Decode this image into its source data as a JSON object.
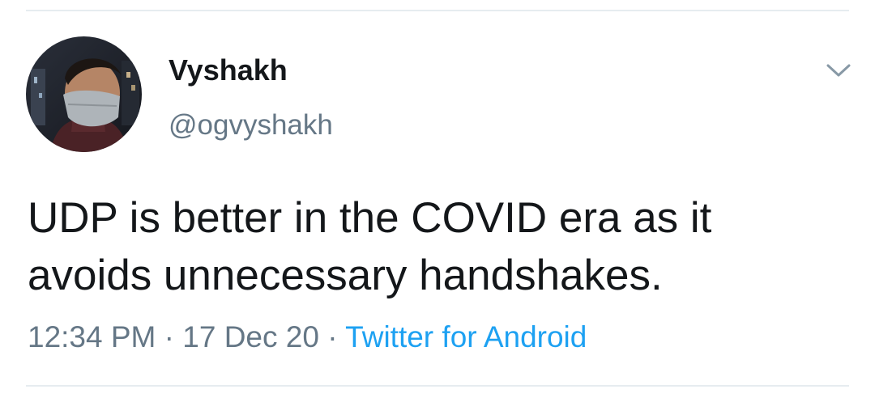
{
  "user": {
    "display_name": "Vyshakh",
    "handle": "@ogvyshakh",
    "avatar_icon": "user-avatar-masked-photo"
  },
  "menu": {
    "icon": "chevron-down-icon"
  },
  "tweet": {
    "text_lines": [
      "UDP is better in the COVID era as it",
      "avoids unnecessary handshakes."
    ],
    "time": "12:34 PM",
    "separator": "·",
    "date": "17 Dec 20",
    "source": "Twitter for Android"
  },
  "colors": {
    "text": "#14171a",
    "secondary": "#657786",
    "link": "#1da1f2",
    "divider": "#e6ecf0"
  }
}
